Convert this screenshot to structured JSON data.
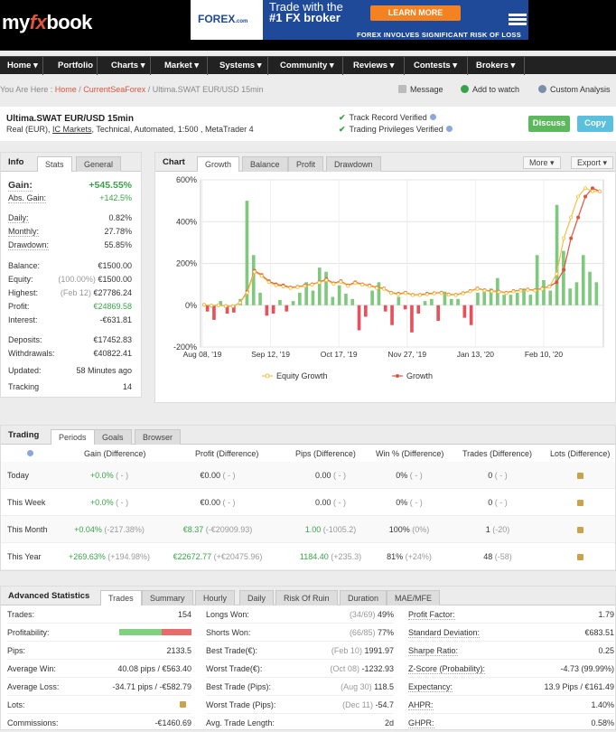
{
  "brand": {
    "logo_my": "my",
    "logo_fx": "fx",
    "logo_book": "book"
  },
  "ad": {
    "logo": "FOREX",
    "logo_com": ".com",
    "line1": "Trade with the",
    "line2": "#1 FX broker",
    "button": "LEARN MORE",
    "risk": "FOREX INVOLVES SIGNIFICANT RISK OF LOSS"
  },
  "nav": [
    {
      "label": "Home ▾"
    },
    {
      "label": "Portfolio"
    },
    {
      "label": "Charts ▾"
    },
    {
      "label": "Market ▾"
    },
    {
      "label": "Systems ▾"
    },
    {
      "label": "Community ▾"
    },
    {
      "label": "Reviews ▾"
    },
    {
      "label": "Contests ▾"
    },
    {
      "label": "Brokers ▾"
    }
  ],
  "breadcrumb": {
    "prefix": "You Are Here : ",
    "home": "Home",
    "sep": " / ",
    "user": "CurrentSeaForex",
    "current": "Ultima.SWAT EUR/USD 15min"
  },
  "actions": {
    "message": "Message",
    "watch": "Add to watch",
    "custom": "Custom Analysis"
  },
  "system": {
    "title": "Ultima.SWAT EUR/USD 15min",
    "sub_prefix": "Real (EUR), ",
    "broker": "IC Markets",
    "sub_suffix": ", Technical, Automated, 1:500 , MetaTrader 4",
    "verified1": "Track Record Verified",
    "verified2": "Trading Privileges Verified",
    "discuss": "Discuss",
    "copy": "Copy"
  },
  "info": {
    "title": "Info",
    "tab_stats": "Stats",
    "tab_general": "General",
    "gain_label": "Gain:",
    "gain_value": "+545.55%",
    "abs_label": "Abs. Gain:",
    "abs_value": "+142.5%",
    "daily_label": "Daily:",
    "daily_value": "0.82%",
    "monthly_label": "Monthly:",
    "monthly_value": "27.78%",
    "drawdown_label": "Drawdown:",
    "drawdown_value": "55.85%",
    "balance_label": "Balance:",
    "balance_value": "€1500.00",
    "equity_label": "Equity:",
    "equity_pct": "(100.00%)",
    "equity_value": "€1500.00",
    "highest_label": "Highest:",
    "highest_date": "(Feb 12)",
    "highest_value": "€27786.24",
    "profit_label": "Profit:",
    "profit_value": "€24869.58",
    "interest_label": "Interest:",
    "interest_value": "-€631.81",
    "deposits_label": "Deposits:",
    "deposits_value": "€17452.83",
    "withdrawals_label": "Withdrawals:",
    "withdrawals_value": "€40822.41",
    "updated_label": "Updated:",
    "updated_value": "58 Minutes ago",
    "tracking_label": "Tracking",
    "tracking_value": "14"
  },
  "chart": {
    "title": "Chart",
    "tabs": [
      "Growth",
      "Balance",
      "Profit",
      "Drawdown"
    ],
    "more": "More",
    "export": "Export",
    "legend_equity": "Equity Growth",
    "legend_growth": "Growth"
  },
  "chart_data": {
    "type": "line",
    "y_ticks": [
      "600%",
      "400%",
      "200%",
      "0%",
      "-200%"
    ],
    "x_ticks": [
      "Aug 08, '19",
      "Sep 12, '19",
      "Oct 17, '19",
      "Nov 27, '19",
      "Jan 13, '20",
      "Feb 10, '20"
    ],
    "ylim": [
      -200,
      600
    ],
    "legend": "bottom",
    "colors": {
      "growth": "#e0533c",
      "equity": "#f0c040",
      "pos_bar": "#7fc97f",
      "neg_bar": "#e8505b"
    },
    "series": [
      {
        "name": "Growth",
        "values": [
          2,
          -2,
          0,
          -4,
          -5,
          12,
          65,
          165,
          145,
          115,
          100,
          95,
          85,
          88,
          95,
          100,
          110,
          125,
          105,
          115,
          95,
          110,
          100,
          95,
          85,
          80,
          60,
          55,
          60,
          50,
          50,
          55,
          58,
          60,
          52,
          50,
          58,
          68,
          80,
          72,
          68,
          65,
          60,
          68,
          72,
          75,
          72,
          80,
          90,
          110,
          170,
          320,
          420,
          520,
          560,
          545
        ]
      },
      {
        "name": "Equity Growth",
        "values": [
          2,
          -2,
          0,
          -4,
          -5,
          12,
          60,
          160,
          140,
          110,
          95,
          90,
          82,
          86,
          92,
          98,
          108,
          120,
          102,
          112,
          92,
          106,
          98,
          92,
          82,
          78,
          58,
          52,
          58,
          48,
          48,
          52,
          56,
          58,
          50,
          48,
          56,
          66,
          78,
          70,
          66,
          63,
          58,
          66,
          70,
          73,
          70,
          78,
          88,
          150,
          320,
          420,
          520,
          560,
          545,
          545
        ]
      }
    ],
    "bars": [
      -30,
      -70,
      20,
      -40,
      -35,
      30,
      500,
      240,
      60,
      -50,
      -40,
      25,
      -30,
      20,
      60,
      110,
      70,
      180,
      160,
      40,
      95,
      55,
      30,
      -120,
      -55,
      70,
      110,
      -30,
      -95,
      40,
      -20,
      -130,
      -40,
      20,
      30,
      -75,
      65,
      30,
      30,
      -60,
      -95,
      60,
      70,
      80,
      130,
      50,
      50,
      60,
      80,
      50,
      240,
      120,
      70,
      480,
      260,
      80,
      110,
      240,
      160,
      110
    ]
  },
  "trading": {
    "title": "Trading",
    "tabs": [
      "Periods",
      "Goals",
      "Browser"
    ],
    "headers": [
      "Gain (Difference)",
      "Profit (Difference)",
      "Pips (Difference)",
      "Win % (Difference)",
      "Trades (Difference)",
      "Lots (Difference)"
    ],
    "rows": [
      {
        "label": "Today",
        "gain": "+0.0%",
        "gain_d": "( - )",
        "profit": "€0.00",
        "profit_d": "( - )",
        "pips": "0.00",
        "pips_d": "( - )",
        "win": "0%",
        "win_d": "( - )",
        "trades": "0",
        "trades_d": "( - )"
      },
      {
        "label": "This Week",
        "gain": "+0.0%",
        "gain_d": "( - )",
        "profit": "€0.00",
        "profit_d": "( - )",
        "pips": "0.00",
        "pips_d": "( - )",
        "win": "0%",
        "win_d": "( - )",
        "trades": "0",
        "trades_d": "( - )"
      },
      {
        "label": "This Month",
        "gain": "+0.04%",
        "gain_d": "(-217.38%)",
        "profit": "€8.37",
        "profit_d": "(-€20909.93)",
        "pips": "1.00",
        "pips_d": "(-1005.2)",
        "win": "100%",
        "win_d": "(0%)",
        "trades": "1",
        "trades_d": "(-20)"
      },
      {
        "label": "This Year",
        "gain": "+269.63%",
        "gain_d": "(+194.98%)",
        "profit": "€22672.77",
        "profit_d": "(+€20475.96)",
        "pips": "1184.40",
        "pips_d": "(+235.3)",
        "win": "81%",
        "win_d": "(+24%)",
        "trades": "48",
        "trades_d": "(-58)"
      }
    ]
  },
  "advanced": {
    "title": "Advanced Statistics",
    "tabs": [
      "Trades",
      "Summary",
      "Hourly",
      "Daily",
      "Risk Of Ruin",
      "Duration",
      "MAE/MFE"
    ],
    "col1": [
      {
        "l": "Trades:",
        "v": "154"
      },
      {
        "l": "Profitability:",
        "v": ""
      },
      {
        "l": "Pips:",
        "v": "2133.5"
      },
      {
        "l": "Average Win:",
        "v": "40.08 pips / €563.40"
      },
      {
        "l": "Average Loss:",
        "v": "-34.71 pips / -€582.79"
      },
      {
        "l": "Lots:",
        "v": ""
      },
      {
        "l": "Commissions:",
        "v": "-€1460.69"
      }
    ],
    "profitability": 0.59,
    "col2": [
      {
        "l": "Longs Won:",
        "g": "(34/69)",
        "v": "49%"
      },
      {
        "l": "Shorts Won:",
        "g": "(66/85)",
        "v": "77%"
      },
      {
        "l": "Best Trade(€):",
        "g": "(Feb 10)",
        "v": "1991.97"
      },
      {
        "l": "Worst Trade(€):",
        "g": "(Oct 08)",
        "v": "-1232.93"
      },
      {
        "l": "Best Trade (Pips):",
        "g": "(Aug 30)",
        "v": "118.5"
      },
      {
        "l": "Worst Trade (Pips):",
        "g": "(Dec 11)",
        "v": "-54.7"
      },
      {
        "l": "Avg. Trade Length:",
        "g": "",
        "v": "2d"
      }
    ],
    "col3": [
      {
        "l": "Profit Factor:",
        "v": "1.79"
      },
      {
        "l": "Standard Deviation:",
        "v": "€683.51"
      },
      {
        "l": "Sharpe Ratio:",
        "v": "0.25"
      },
      {
        "l": "Z-Score (Probability):",
        "v": "-4.73 (99.99%)"
      },
      {
        "l": "Expectancy:",
        "v": "13.9 Pips / €161.49"
      },
      {
        "l": "AHPR:",
        "v": "1.40%"
      },
      {
        "l": "GHPR:",
        "v": "0.58%"
      }
    ]
  }
}
